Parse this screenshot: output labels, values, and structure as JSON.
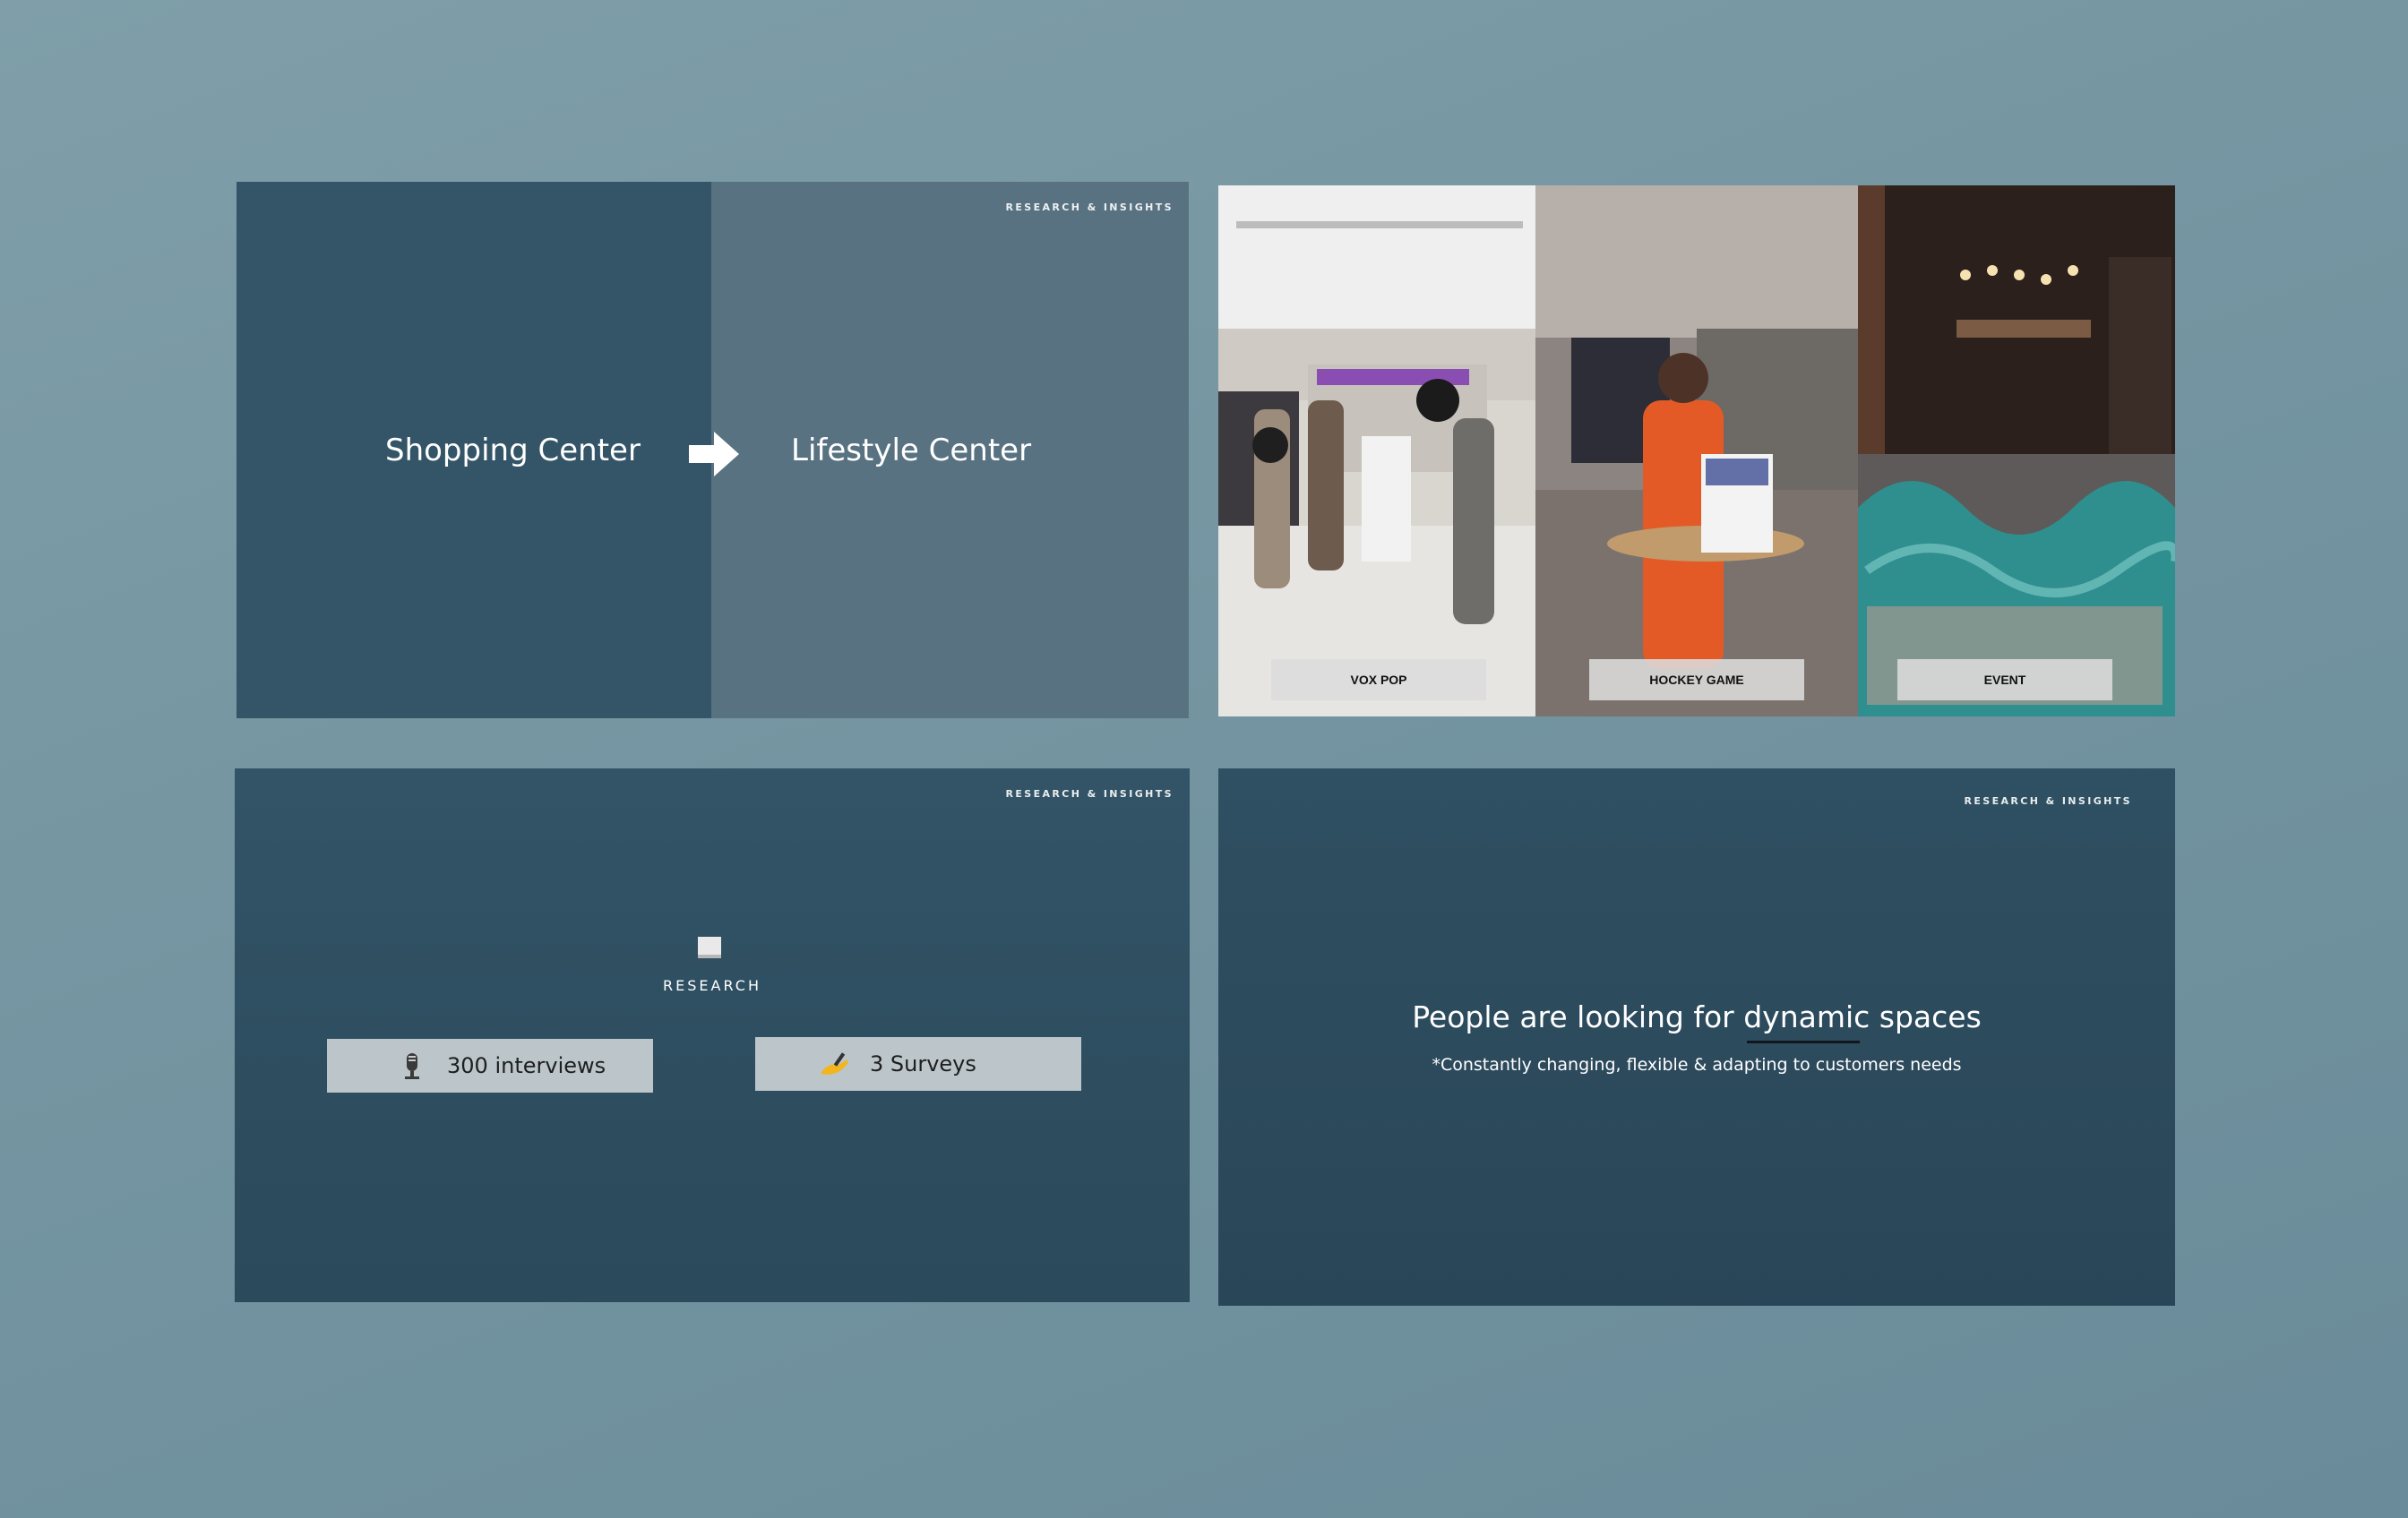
{
  "colors": {
    "background": "#7a98a5",
    "slide_dark": "#345567",
    "slide_mid": "#587281",
    "label_bg": "#dcdcdc",
    "stat_bg": "#bbc5ca"
  },
  "slide1": {
    "tag": "RESEARCH & INSIGHTS",
    "from_text": "Shopping Center",
    "to_text": "Lifestyle Center",
    "arrow_icon": "right-arrow-icon"
  },
  "slide2": {
    "photos": [
      {
        "label": "VOX POP",
        "icon": "mall-photo"
      },
      {
        "label": "HOCKEY GAME",
        "icon": "hockey-photo"
      },
      {
        "label": "EVENT",
        "icon": "event-photo"
      }
    ]
  },
  "slide3": {
    "tag": "RESEARCH & INSIGHTS",
    "caption": "RESEARCH",
    "caption_icon": "clipboard-icon",
    "stats": [
      {
        "label": "300 interviews",
        "icon": "microphone-icon"
      },
      {
        "label": "3 Surveys",
        "icon": "writing-hand-icon"
      }
    ]
  },
  "slide4": {
    "tag": "RESEARCH & INSIGHTS",
    "headline": "People are looking for dynamic spaces",
    "sub": "*Constantly changing, flexible & adapting to customers needs"
  }
}
